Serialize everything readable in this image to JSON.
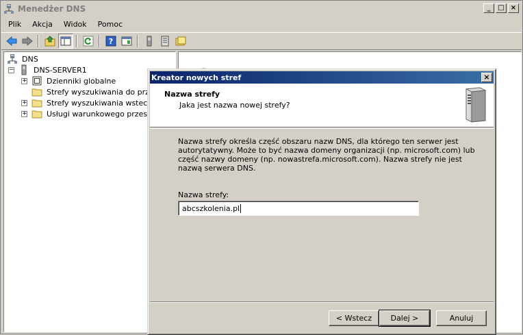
{
  "window": {
    "title": "Menedżer DNS",
    "controls": {
      "minimize": "_",
      "maximize": "□",
      "close": "×"
    }
  },
  "menu": [
    "Plik",
    "Akcja",
    "Widok",
    "Pomoc"
  ],
  "toolbar": {
    "buttons": [
      "back-arrow-icon",
      "forward-arrow-icon",
      "up-folder-icon",
      "show-hide-tree-icon",
      "refresh-icon",
      "help-icon",
      "properties-icon",
      "server-icon",
      "list-icon",
      "folder-icon"
    ]
  },
  "tree": {
    "root": "DNS",
    "server": "DNS-SERVER1",
    "items": [
      {
        "label": "Dzienniki globalne",
        "expander": "+"
      },
      {
        "label": "Strefy wyszukiwania do przodu",
        "expander": ""
      },
      {
        "label": "Strefy wyszukiwania wstecznego",
        "expander": "+"
      },
      {
        "label": "Usługi warunkowego przesyłania dalej",
        "expander": "+"
      }
    ],
    "server_expander": "−"
  },
  "dialog": {
    "title": "Kreator nowych stref",
    "close": "×",
    "header_title": "Nazwa strefy",
    "header_subtitle": "Jaka jest nazwa nowej strefy?",
    "description": "Nazwa strefy określa część obszaru nazw DNS, dla którego ten serwer jest autorytatywny. Może to być nazwa domeny organizacji (np. microsoft.com) lub część nazwy domeny (np. nowastrefa.microsoft.com). Nazwa strefy nie jest nazwą serwera DNS.",
    "field_label": "Nazwa strefy:",
    "field_value": "abcszkolenia.pl",
    "buttons": {
      "back": "< Wstecz",
      "next": "Dalej >",
      "cancel": "Anuluj"
    }
  },
  "colors": {
    "title_bar_start": "#0a246a",
    "title_bar_end": "#3a6ea5",
    "chrome": "#d4d0c8"
  }
}
